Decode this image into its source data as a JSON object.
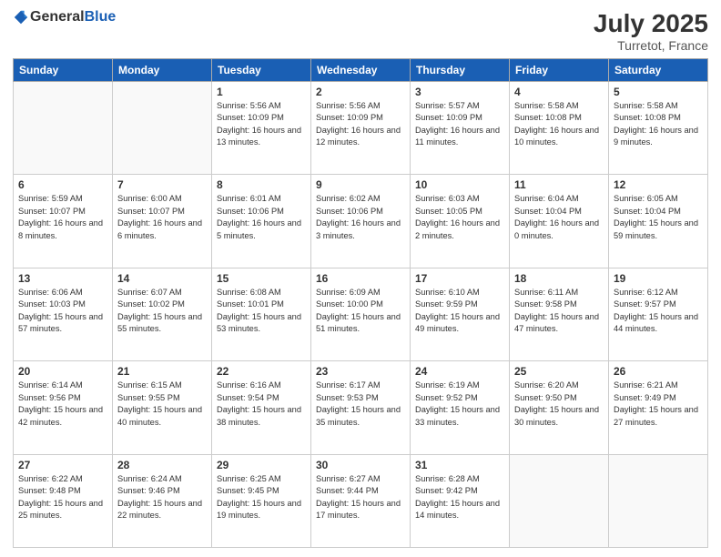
{
  "header": {
    "logo_general": "General",
    "logo_blue": "Blue",
    "month_year": "July 2025",
    "location": "Turretot, France"
  },
  "weekdays": [
    "Sunday",
    "Monday",
    "Tuesday",
    "Wednesday",
    "Thursday",
    "Friday",
    "Saturday"
  ],
  "weeks": [
    [
      {
        "day": "",
        "info": ""
      },
      {
        "day": "",
        "info": ""
      },
      {
        "day": "1",
        "info": "Sunrise: 5:56 AM\nSunset: 10:09 PM\nDaylight: 16 hours and 13 minutes."
      },
      {
        "day": "2",
        "info": "Sunrise: 5:56 AM\nSunset: 10:09 PM\nDaylight: 16 hours and 12 minutes."
      },
      {
        "day": "3",
        "info": "Sunrise: 5:57 AM\nSunset: 10:09 PM\nDaylight: 16 hours and 11 minutes."
      },
      {
        "day": "4",
        "info": "Sunrise: 5:58 AM\nSunset: 10:08 PM\nDaylight: 16 hours and 10 minutes."
      },
      {
        "day": "5",
        "info": "Sunrise: 5:58 AM\nSunset: 10:08 PM\nDaylight: 16 hours and 9 minutes."
      }
    ],
    [
      {
        "day": "6",
        "info": "Sunrise: 5:59 AM\nSunset: 10:07 PM\nDaylight: 16 hours and 8 minutes."
      },
      {
        "day": "7",
        "info": "Sunrise: 6:00 AM\nSunset: 10:07 PM\nDaylight: 16 hours and 6 minutes."
      },
      {
        "day": "8",
        "info": "Sunrise: 6:01 AM\nSunset: 10:06 PM\nDaylight: 16 hours and 5 minutes."
      },
      {
        "day": "9",
        "info": "Sunrise: 6:02 AM\nSunset: 10:06 PM\nDaylight: 16 hours and 3 minutes."
      },
      {
        "day": "10",
        "info": "Sunrise: 6:03 AM\nSunset: 10:05 PM\nDaylight: 16 hours and 2 minutes."
      },
      {
        "day": "11",
        "info": "Sunrise: 6:04 AM\nSunset: 10:04 PM\nDaylight: 16 hours and 0 minutes."
      },
      {
        "day": "12",
        "info": "Sunrise: 6:05 AM\nSunset: 10:04 PM\nDaylight: 15 hours and 59 minutes."
      }
    ],
    [
      {
        "day": "13",
        "info": "Sunrise: 6:06 AM\nSunset: 10:03 PM\nDaylight: 15 hours and 57 minutes."
      },
      {
        "day": "14",
        "info": "Sunrise: 6:07 AM\nSunset: 10:02 PM\nDaylight: 15 hours and 55 minutes."
      },
      {
        "day": "15",
        "info": "Sunrise: 6:08 AM\nSunset: 10:01 PM\nDaylight: 15 hours and 53 minutes."
      },
      {
        "day": "16",
        "info": "Sunrise: 6:09 AM\nSunset: 10:00 PM\nDaylight: 15 hours and 51 minutes."
      },
      {
        "day": "17",
        "info": "Sunrise: 6:10 AM\nSunset: 9:59 PM\nDaylight: 15 hours and 49 minutes."
      },
      {
        "day": "18",
        "info": "Sunrise: 6:11 AM\nSunset: 9:58 PM\nDaylight: 15 hours and 47 minutes."
      },
      {
        "day": "19",
        "info": "Sunrise: 6:12 AM\nSunset: 9:57 PM\nDaylight: 15 hours and 44 minutes."
      }
    ],
    [
      {
        "day": "20",
        "info": "Sunrise: 6:14 AM\nSunset: 9:56 PM\nDaylight: 15 hours and 42 minutes."
      },
      {
        "day": "21",
        "info": "Sunrise: 6:15 AM\nSunset: 9:55 PM\nDaylight: 15 hours and 40 minutes."
      },
      {
        "day": "22",
        "info": "Sunrise: 6:16 AM\nSunset: 9:54 PM\nDaylight: 15 hours and 38 minutes."
      },
      {
        "day": "23",
        "info": "Sunrise: 6:17 AM\nSunset: 9:53 PM\nDaylight: 15 hours and 35 minutes."
      },
      {
        "day": "24",
        "info": "Sunrise: 6:19 AM\nSunset: 9:52 PM\nDaylight: 15 hours and 33 minutes."
      },
      {
        "day": "25",
        "info": "Sunrise: 6:20 AM\nSunset: 9:50 PM\nDaylight: 15 hours and 30 minutes."
      },
      {
        "day": "26",
        "info": "Sunrise: 6:21 AM\nSunset: 9:49 PM\nDaylight: 15 hours and 27 minutes."
      }
    ],
    [
      {
        "day": "27",
        "info": "Sunrise: 6:22 AM\nSunset: 9:48 PM\nDaylight: 15 hours and 25 minutes."
      },
      {
        "day": "28",
        "info": "Sunrise: 6:24 AM\nSunset: 9:46 PM\nDaylight: 15 hours and 22 minutes."
      },
      {
        "day": "29",
        "info": "Sunrise: 6:25 AM\nSunset: 9:45 PM\nDaylight: 15 hours and 19 minutes."
      },
      {
        "day": "30",
        "info": "Sunrise: 6:27 AM\nSunset: 9:44 PM\nDaylight: 15 hours and 17 minutes."
      },
      {
        "day": "31",
        "info": "Sunrise: 6:28 AM\nSunset: 9:42 PM\nDaylight: 15 hours and 14 minutes."
      },
      {
        "day": "",
        "info": ""
      },
      {
        "day": "",
        "info": ""
      }
    ]
  ]
}
